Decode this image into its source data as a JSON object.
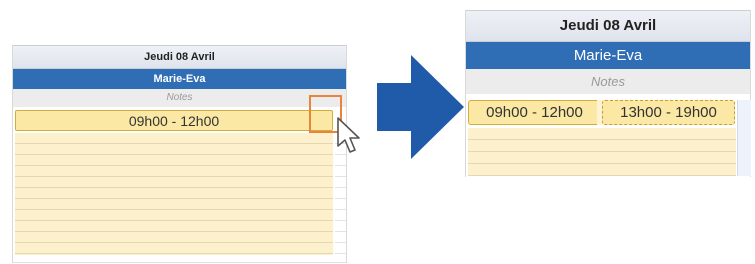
{
  "before": {
    "date_header": "Jeudi 08 Avril",
    "person_name": "Marie-Eva",
    "notes_label": "Notes",
    "slot_label": "09h00 - 12h00"
  },
  "after": {
    "date_header": "Jeudi 08 Avril",
    "person_name": "Marie-Eva",
    "notes_label": "Notes",
    "slots": [
      {
        "label": "09h00 - 12h00"
      },
      {
        "label": "13h00 - 19h00"
      }
    ]
  },
  "colors": {
    "header_bg": "#e6eaf1",
    "person_bg": "#2f6db5",
    "notes_bg": "#ececec",
    "slot_bg": "#fbe8a5",
    "slot_border": "#d2ad3c",
    "empty_bg": "#fdf1cd",
    "highlight": "#e8843b",
    "arrow": "#1f5ba8"
  },
  "icons": {
    "cursor": "mouse-pointer-icon",
    "arrow": "right-arrow-icon"
  }
}
